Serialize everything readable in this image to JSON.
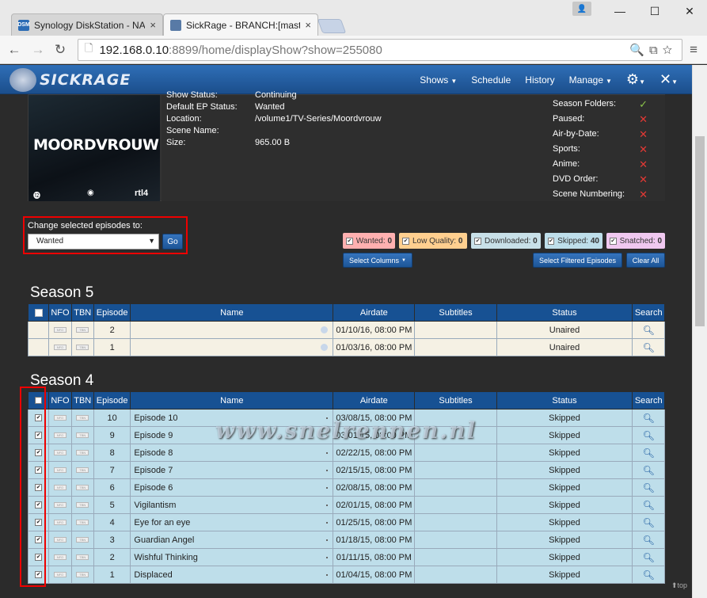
{
  "browser": {
    "tabs": [
      {
        "label": "Synology DiskStation - NA",
        "favicon": "DSM"
      },
      {
        "label": "SickRage - BRANCH:[maste",
        "favicon": "SR"
      }
    ],
    "url_host": "192.168.0.10",
    "url_rest": ":8899/home/displayShow?show=255080"
  },
  "nav": {
    "logo": "SICKRAGE",
    "items": [
      {
        "label": "Shows",
        "caret": true
      },
      {
        "label": "Schedule"
      },
      {
        "label": "History"
      },
      {
        "label": "Manage",
        "caret": true
      }
    ]
  },
  "show": {
    "poster_title": "MOORDVROUW",
    "poster_channel": "rtl4",
    "info": [
      {
        "key": "Show Status:",
        "value": "Continuing"
      },
      {
        "key": "Default EP Status:",
        "value": "Wanted"
      },
      {
        "key": "Location:",
        "value": "/volume1/TV-Series/Moordvrouw"
      },
      {
        "key": "Scene Name:",
        "value": ""
      },
      {
        "key": "Size:",
        "value": "965.00 B"
      }
    ],
    "flags": [
      {
        "label": "Season Folders:",
        "value": "✓",
        "ok": true
      },
      {
        "label": "Paused:",
        "value": "✕",
        "ok": false
      },
      {
        "label": "Air-by-Date:",
        "value": "✕",
        "ok": false
      },
      {
        "label": "Sports:",
        "value": "✕",
        "ok": false
      },
      {
        "label": "Anime:",
        "value": "✕",
        "ok": false
      },
      {
        "label": "DVD Order:",
        "value": "✕",
        "ok": false
      },
      {
        "label": "Scene Numbering:",
        "value": "✕",
        "ok": false
      }
    ]
  },
  "change": {
    "label": "Change selected episodes to:",
    "selected": "Wanted",
    "go": "Go"
  },
  "filters": [
    {
      "label": "Wanted:",
      "count": "0",
      "color": "#ffb0b0"
    },
    {
      "label": "Low Quality:",
      "count": "0",
      "color": "#ffcf8f"
    },
    {
      "label": "Downloaded:",
      "count": "0",
      "color": "#c8e0e8"
    },
    {
      "label": "Skipped:",
      "count": "40",
      "color": "#bedeea"
    },
    {
      "label": "Snatched:",
      "count": "0",
      "color": "#f0c8f0"
    }
  ],
  "buttons": {
    "select_columns": "Select Columns",
    "select_filtered": "Select Filtered Episodes",
    "clear_all": "Clear All"
  },
  "columns": [
    "NFO",
    "TBN",
    "Episode",
    "Name",
    "Airdate",
    "Subtitles",
    "Status",
    "Search"
  ],
  "seasons": [
    {
      "title": "Season 5",
      "episodes": [
        {
          "ep": "2",
          "name": "",
          "airdate": "01/10/16, 08:00 PM",
          "status": "Unaired"
        },
        {
          "ep": "1",
          "name": "",
          "airdate": "01/03/16, 08:00 PM",
          "status": "Unaired"
        }
      ]
    },
    {
      "title": "Season 4",
      "episodes": [
        {
          "ep": "10",
          "name": "Episode 10",
          "airdate": "03/08/15, 08:00 PM",
          "status": "Skipped"
        },
        {
          "ep": "9",
          "name": "Episode 9",
          "airdate": "03/01/15, 08:00 PM",
          "status": "Skipped"
        },
        {
          "ep": "8",
          "name": "Episode 8",
          "airdate": "02/22/15, 08:00 PM",
          "status": "Skipped"
        },
        {
          "ep": "7",
          "name": "Episode 7",
          "airdate": "02/15/15, 08:00 PM",
          "status": "Skipped"
        },
        {
          "ep": "6",
          "name": "Episode 6",
          "airdate": "02/08/15, 08:00 PM",
          "status": "Skipped"
        },
        {
          "ep": "5",
          "name": "Vigilantism",
          "airdate": "02/01/15, 08:00 PM",
          "status": "Skipped"
        },
        {
          "ep": "4",
          "name": "Eye for an eye",
          "airdate": "01/25/15, 08:00 PM",
          "status": "Skipped"
        },
        {
          "ep": "3",
          "name": "Guardian Angel",
          "airdate": "01/18/15, 08:00 PM",
          "status": "Skipped"
        },
        {
          "ep": "2",
          "name": "Wishful Thinking",
          "airdate": "01/11/15, 08:00 PM",
          "status": "Skipped"
        },
        {
          "ep": "1",
          "name": "Displaced",
          "airdate": "01/04/15, 08:00 PM",
          "status": "Skipped"
        }
      ]
    }
  ],
  "watermark": "www.snelrennen.nl",
  "totop": "top"
}
